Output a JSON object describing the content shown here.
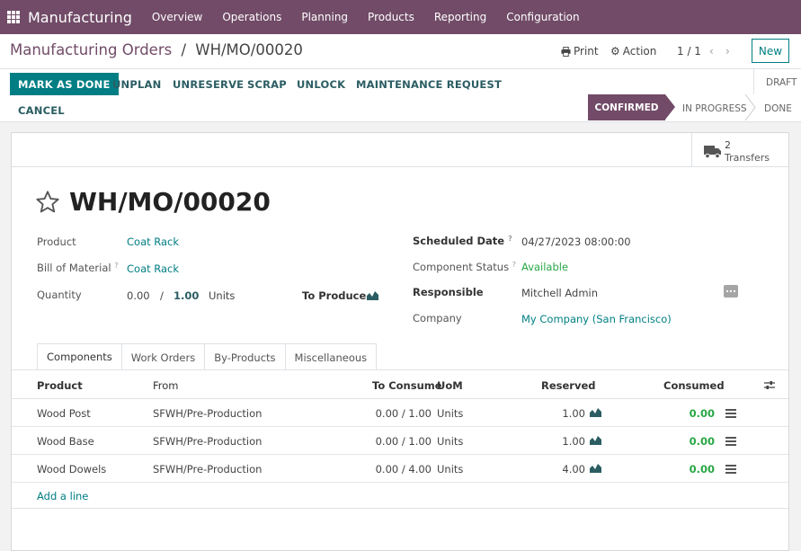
{
  "app": {
    "name": "Manufacturing",
    "menu": [
      "Overview",
      "Operations",
      "Planning",
      "Products",
      "Reporting",
      "Configuration"
    ]
  },
  "control_panel": {
    "breadcrumb_parent": "Manufacturing Orders",
    "breadcrumb_sep": "/",
    "breadcrumb_current": "WH/MO/00020",
    "print_label": "Print",
    "action_label": "Action",
    "pager": "1 / 1",
    "new_label": "New"
  },
  "status_bar": {
    "buttons": {
      "mark_as_done": "MARK AS DONE",
      "unplan": "UNPLAN",
      "unreserve": "UNRESERVE",
      "scrap": "SCRAP",
      "unlock": "UNLOCK",
      "maintenance_request": "MAINTENANCE REQUEST",
      "cancel": "CANCEL"
    },
    "stages": {
      "draft": "DRAFT",
      "confirmed": "CONFIRMED",
      "in_progress": "IN PROGRESS",
      "done": "DONE"
    },
    "active_stage": "CONFIRMED"
  },
  "smart_button": {
    "count": "2",
    "label": "Transfers"
  },
  "record": {
    "title": "WH/MO/00020",
    "fields": {
      "product_label": "Product",
      "product_value": "Coat Rack",
      "bom_label": "Bill of Material",
      "bom_value": "Coat Rack",
      "quantity_label": "Quantity",
      "quantity_done": "0.00",
      "quantity_sep": "/",
      "quantity_total": "1.00",
      "quantity_uom": "Units",
      "to_produce_label": "To Produce",
      "scheduled_date_label": "Scheduled Date",
      "scheduled_date_value": "04/27/2023 08:00:00",
      "component_status_label": "Component Status",
      "component_status_value": "Available",
      "responsible_label": "Responsible",
      "responsible_value": "Mitchell Admin",
      "company_label": "Company",
      "company_value": "My Company (San Francisco)",
      "help_mark": "?"
    }
  },
  "tabs": [
    "Components",
    "Work Orders",
    "By-Products",
    "Miscellaneous"
  ],
  "components_table": {
    "headers": {
      "product": "Product",
      "from": "From",
      "to_consume": "To Consume",
      "uom": "UoM",
      "reserved": "Reserved",
      "consumed": "Consumed"
    },
    "rows": [
      {
        "product": "Wood Post",
        "from": "SFWH/Pre-Production",
        "to_consume": "0.00 /  1.00",
        "uom": "Units",
        "reserved": "1.00",
        "consumed": "0.00"
      },
      {
        "product": "Wood Base",
        "from": "SFWH/Pre-Production",
        "to_consume": "0.00 /  1.00",
        "uom": "Units",
        "reserved": "1.00",
        "consumed": "0.00"
      },
      {
        "product": "Wood Dowels",
        "from": "SFWH/Pre-Production",
        "to_consume": "0.00 /  4.00",
        "uom": "Units",
        "reserved": "4.00",
        "consumed": "0.00"
      }
    ],
    "add_line": "Add a line"
  },
  "colors": {
    "brand": "#714b67",
    "accent": "#017e84",
    "success": "#28a745"
  }
}
